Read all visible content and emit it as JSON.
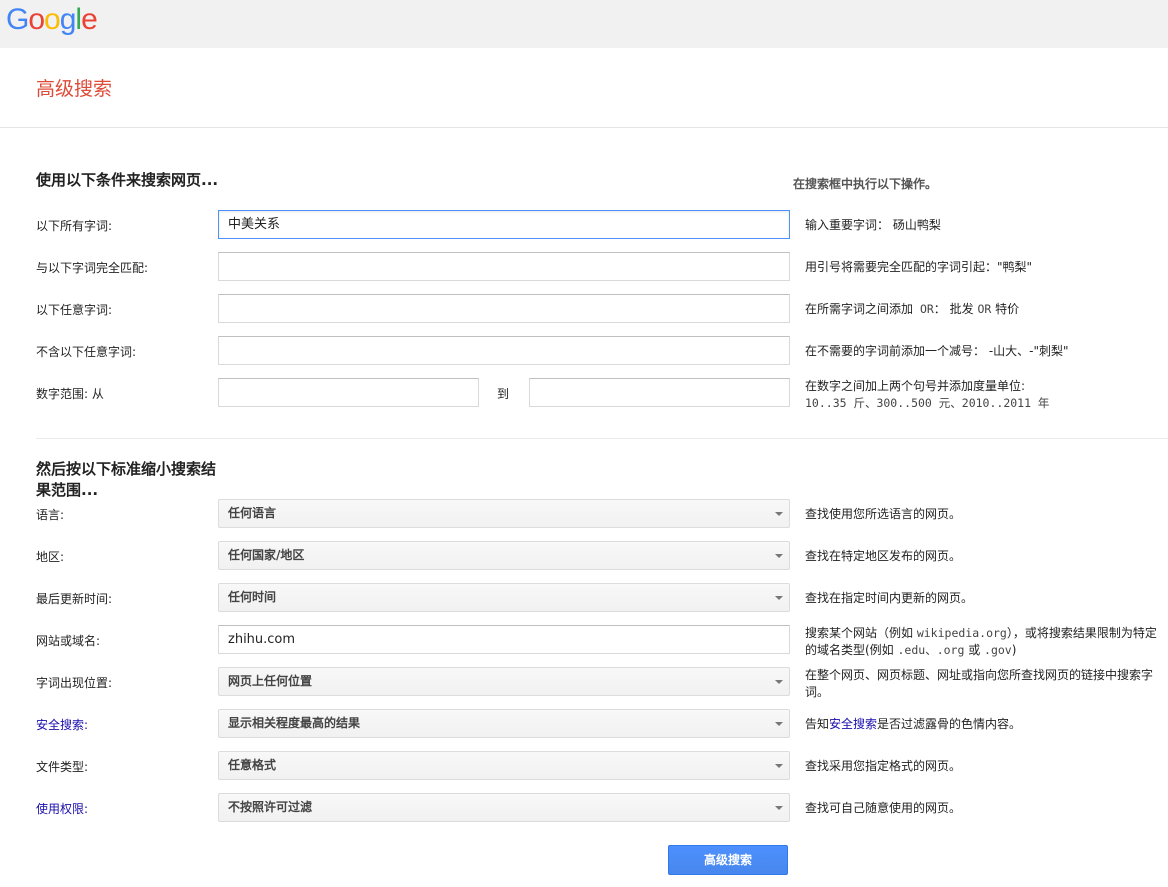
{
  "logo": {
    "letters": [
      "G",
      "o",
      "o",
      "g",
      "l",
      "e"
    ],
    "colors": [
      "#4285f4",
      "#ea4335",
      "#fbbc05",
      "#4285f4",
      "#34a853",
      "#ea4335"
    ]
  },
  "page_title": "高级搜索",
  "section1": {
    "title": "使用以下条件来搜索网页...",
    "hint_header": "在搜索框中执行以下操作。",
    "rows": {
      "all_words": {
        "label": "以下所有字词:",
        "value": "中美关系",
        "hint": "输入重要字词： 砀山鸭梨"
      },
      "exact": {
        "label": "与以下字词完全匹配:",
        "value": "",
        "hint": "用引号将需要完全匹配的字词引起：\"鸭梨\""
      },
      "any_words": {
        "label": "以下任意字词:",
        "value": "",
        "hint_pre": "在所需字词之间添加",
        "hint_or1": " OR",
        "hint_mid": "： 批发 ",
        "hint_or2": "OR",
        "hint_post": " 特价"
      },
      "none_words": {
        "label": "不含以下任意字词:",
        "value": "",
        "hint": "在不需要的字词前添加一个减号： -山大、-\"刺梨\""
      },
      "range": {
        "label": "数字范围: 从",
        "from": "",
        "to_label": "到",
        "to": "",
        "hint_line1": "在数字之间加上两个句号并添加度量单位:",
        "hint_line2": "10..35 斤、300..500 元、2010..2011 年"
      }
    }
  },
  "section2": {
    "title": "然后按以下标准缩小搜索结果范围...",
    "rows": {
      "language": {
        "label": "语言:",
        "value": "任何语言",
        "hint": "查找使用您所选语言的网页。"
      },
      "region": {
        "label": "地区:",
        "value": "任何国家/地区",
        "hint": "查找在特定地区发布的网页。"
      },
      "last_update": {
        "label": "最后更新时间:",
        "value": "任何时间",
        "hint": "查找在指定时间内更新的网页。"
      },
      "site": {
        "label": "网站或域名:",
        "value": "zhihu.com",
        "hint_pre": "搜索某个网站（例如 ",
        "hint_mono1": "wikipedia.org",
        "hint_mid": "），或将搜索结果限制为特定的域名类型(例如 ",
        "hint_mono2": ".edu、.org",
        "hint_or": " 或 ",
        "hint_mono3": ".gov",
        "hint_post": ")"
      },
      "occurrence": {
        "label": "字词出现位置:",
        "value": "网页上任何位置",
        "hint": "在整个网页、网页标题、网址或指向您所查找网页的链接中搜索字词。"
      },
      "safe_search": {
        "label": "安全搜索:",
        "value": "显示相关程度最高的结果",
        "hint_pre": "告知",
        "hint_link": "安全搜索",
        "hint_post": "是否过滤露骨的色情内容。"
      },
      "file_type": {
        "label": "文件类型:",
        "value": "任意格式",
        "hint": "查找采用您指定格式的网页。"
      },
      "usage_rights": {
        "label": "使用权限:",
        "value": "不按照许可过滤",
        "hint": "查找可自己随意使用的网页。"
      }
    }
  },
  "submit_label": "高级搜索"
}
